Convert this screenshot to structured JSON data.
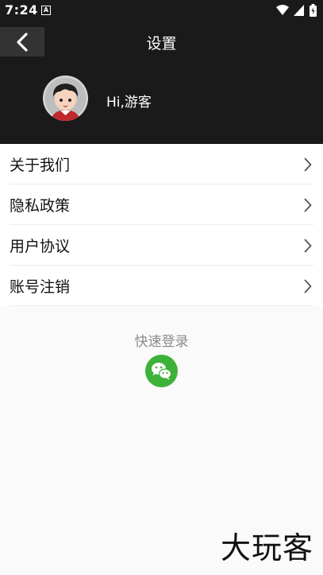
{
  "status_bar": {
    "time": "7:24",
    "notification_glyph": "A",
    "icons": [
      "wifi-icon",
      "signal-icon",
      "battery-icon"
    ]
  },
  "header": {
    "title": "设置",
    "greeting": "Hi,游客"
  },
  "menu": {
    "items": [
      {
        "label": "关于我们"
      },
      {
        "label": "隐私政策"
      },
      {
        "label": "用户协议"
      },
      {
        "label": "账号注销"
      }
    ]
  },
  "quick_login": {
    "label": "快速登录",
    "provider_icon": "wechat-icon"
  },
  "watermark": {
    "text": "大玩客"
  },
  "colors": {
    "header_bg": "#1a1a1a",
    "back_button_bg": "#333333",
    "wechat_green": "#3db23a",
    "page_bg": "#fafafa"
  }
}
